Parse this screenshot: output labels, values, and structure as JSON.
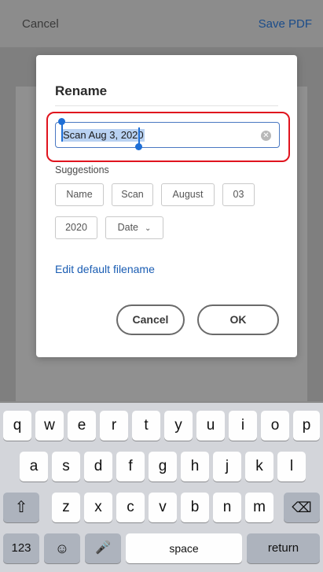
{
  "topbar": {
    "cancel_label": "Cancel",
    "save_label": "Save PDF"
  },
  "dialog": {
    "title": "Rename",
    "filename_value": "Scan Aug 3, 2020",
    "suggestions_label": "Suggestions",
    "suggestions": [
      "Name",
      "Scan",
      "August",
      "03",
      "2020",
      "Date"
    ],
    "edit_link": "Edit default filename",
    "cancel_label": "Cancel",
    "ok_label": "OK"
  },
  "keyboard": {
    "row1": [
      "q",
      "w",
      "e",
      "r",
      "t",
      "y",
      "u",
      "i",
      "o",
      "p"
    ],
    "row2": [
      "a",
      "s",
      "d",
      "f",
      "g",
      "h",
      "j",
      "k",
      "l"
    ],
    "row3": [
      "z",
      "x",
      "c",
      "v",
      "b",
      "n",
      "m"
    ],
    "shift_icon": "shift-arrow-icon",
    "delete_icon": "backspace-icon",
    "numbers_label": "123",
    "emoji_icon": "emoji-icon",
    "mic_icon": "microphone-icon",
    "space_label": "space",
    "return_label": "return"
  },
  "colors": {
    "accent": "#1f6fd6",
    "highlight_ring": "#e0141e",
    "link": "#1a5db3"
  }
}
